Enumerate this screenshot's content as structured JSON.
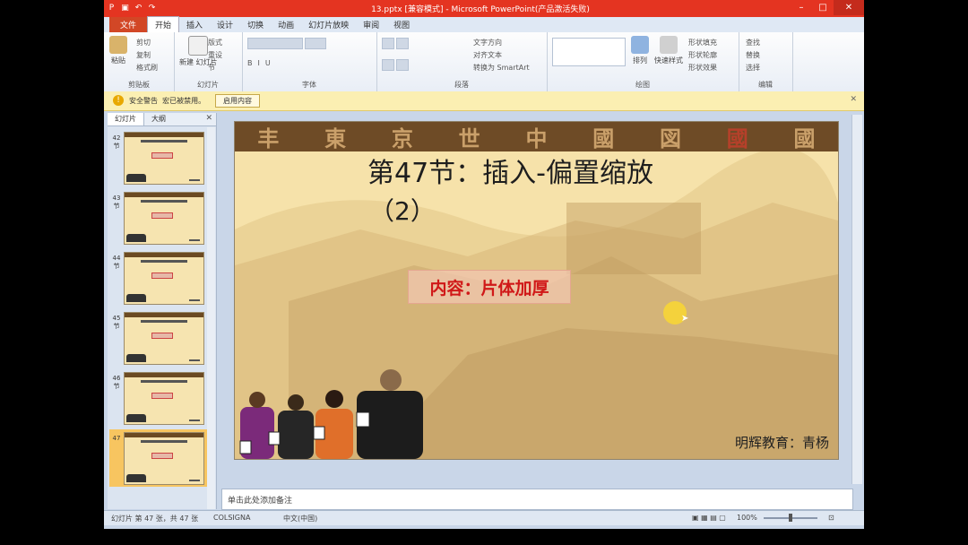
{
  "window": {
    "title": "13.pptx [兼容模式] - Microsoft PowerPoint(产品激活失败)"
  },
  "ribbon_tabs": [
    "文件",
    "开始",
    "插入",
    "设计",
    "切换",
    "动画",
    "幻灯片放映",
    "审阅",
    "视图"
  ],
  "ribbon": {
    "clipboard": {
      "paste": "粘贴",
      "cut": "剪切",
      "copy": "复制",
      "format_painter": "格式刷",
      "label": "剪贴板"
    },
    "slides": {
      "new_slide": "新建\n幻灯片",
      "layout": "版式",
      "reset": "重设",
      "section": "节",
      "label": "幻灯片"
    },
    "font": {
      "label": "字体"
    },
    "paragraph": {
      "text_direction": "文字方向",
      "align_text": "对齐文本",
      "smartart": "转换为 SmartArt",
      "label": "段落"
    },
    "drawing": {
      "arrange": "排列",
      "quick_styles": "快速样式",
      "shape_fill": "形状填充",
      "shape_outline": "形状轮廓",
      "shape_effects": "形状效果",
      "label": "绘图"
    },
    "editing": {
      "find": "查找",
      "replace": "替换",
      "select": "选择",
      "label": "编辑"
    }
  },
  "security": {
    "label": "安全警告",
    "message": "宏已被禁用。",
    "button": "启用内容"
  },
  "pane": {
    "tab_slides": "幻灯片",
    "tab_outline": "大纲"
  },
  "thumbnails": [
    {
      "num": "42\n节"
    },
    {
      "num": "43\n节"
    },
    {
      "num": "44\n节"
    },
    {
      "num": "45\n节"
    },
    {
      "num": "46\n节"
    },
    {
      "num": "47"
    }
  ],
  "slide": {
    "title_line1": "第47节：插入-偏置缩放",
    "title_line2": "（2）",
    "content": "内容：片体加厚",
    "footer": "明辉教育：青杨",
    "seals": [
      "丰",
      "東",
      "京",
      "世",
      "中",
      "國",
      "図",
      "國",
      "國"
    ]
  },
  "notes": {
    "placeholder": "单击此处添加备注"
  },
  "status": {
    "slide_info": "幻灯片 第 47 张，共 47 张",
    "theme": "COLSIGNA",
    "language": "中文(中国)",
    "zoom": "100%"
  },
  "colors": {
    "titlebar": "#e43421",
    "slide_bg": "#f6e2aa",
    "content_red": "#d01818",
    "band": "#6e4b26"
  }
}
